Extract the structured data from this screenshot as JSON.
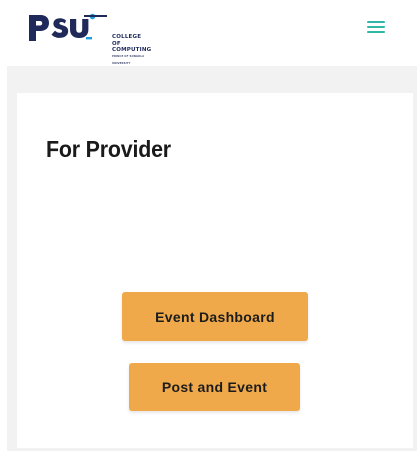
{
  "header": {
    "logo": {
      "mark": "PSU",
      "line1": "COLLEGE OF",
      "line2": "COMPUTING",
      "line3": "PRINCE OF SONGKLA UNIVERSITY"
    },
    "menu_icon": "hamburger-icon"
  },
  "main": {
    "title": "For Provider",
    "buttons": {
      "event_dashboard": "Event Dashboard",
      "post_event": "Post and Event"
    }
  },
  "colors": {
    "accent": "#efa94a",
    "menu": "#2fb8a6",
    "logo_navy": "#1f2a5a",
    "logo_cyan": "#1ea0e0",
    "background_band": "#f1f2f1"
  }
}
